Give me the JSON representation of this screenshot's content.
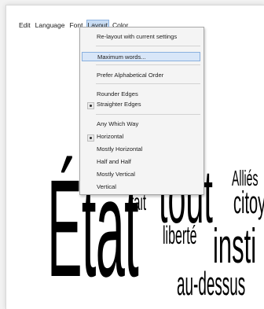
{
  "menubar": {
    "items": [
      "Edit",
      "Language",
      "Font",
      "Layout",
      "Color"
    ]
  },
  "layout_menu": {
    "relayout": "Re-layout with current settings",
    "maximum_words": "Maximum words...",
    "prefer_alpha": "Prefer Alphabetical Order",
    "rounder_edges": "Rounder Edges",
    "straighter_edges": "Straighter Edges",
    "any_which_way": "Any Which Way",
    "horizontal": "Horizontal",
    "mostly_horizontal": "Mostly Horizontal",
    "half_and_half": "Half and Half",
    "mostly_vertical": "Mostly Vertical",
    "vertical": "Vertical"
  },
  "cloud": {
    "etat": "État",
    "fait": "fait",
    "tout": "tout",
    "allies": "Alliés",
    "citoy": "citoy",
    "liberte": "liberté",
    "insti": "insti",
    "au_dessus": "au-dessus"
  }
}
